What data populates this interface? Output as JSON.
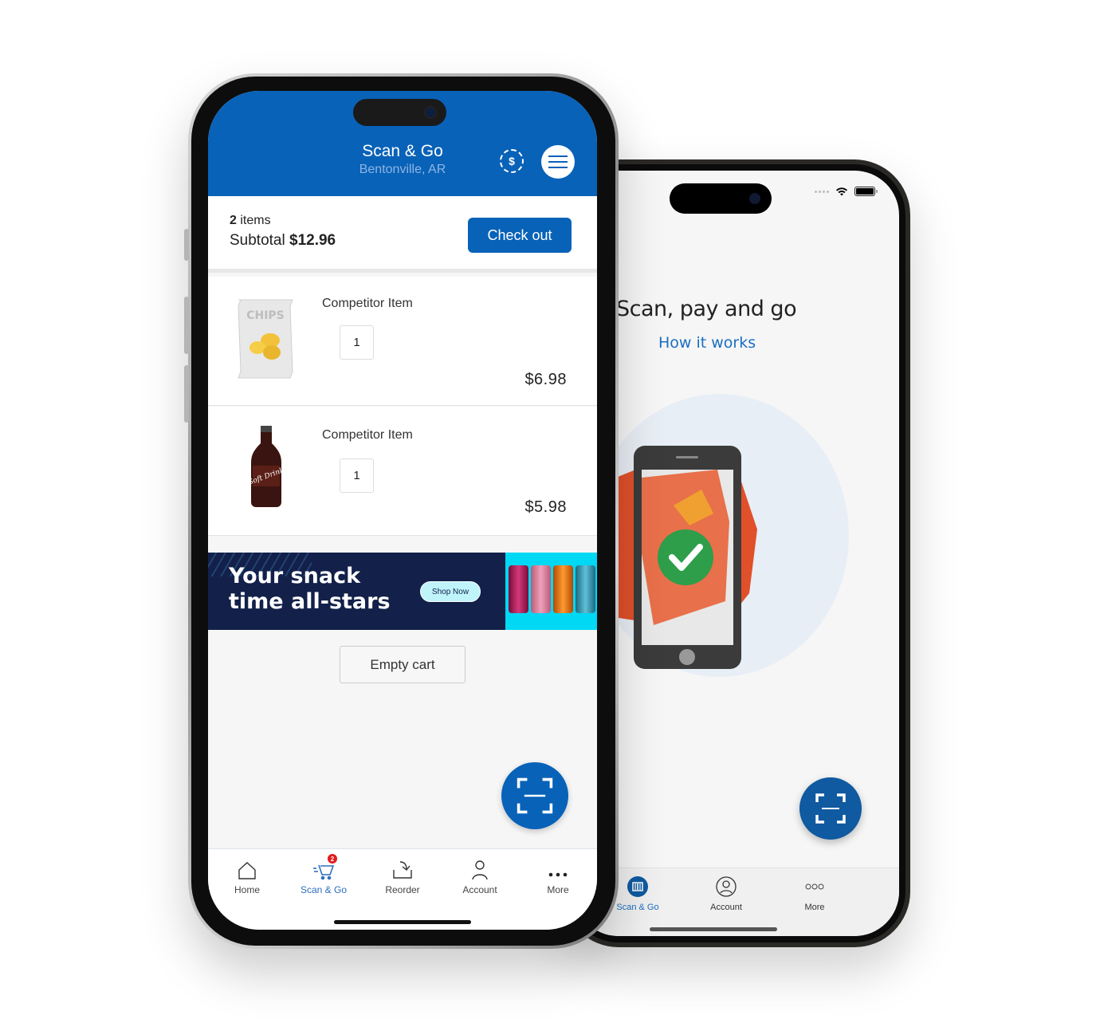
{
  "back_phone": {
    "headline": "Scan, pay and go",
    "link": "How it works",
    "tabs": [
      {
        "label": "Scan & Go",
        "icon": "barcode-icon",
        "active": true
      },
      {
        "label": "Account",
        "icon": "account-icon",
        "active": false
      },
      {
        "label": "More",
        "icon": "more-icon",
        "active": false
      }
    ]
  },
  "front_phone": {
    "header": {
      "title": "Scan & Go",
      "location": "Bentonville, AR",
      "dollar_icon": "$"
    },
    "summary": {
      "item_count": "2",
      "items_label": "items",
      "subtotal_label": "Subtotal",
      "subtotal_value": "$12.96",
      "checkout_label": "Check out"
    },
    "cart_items": [
      {
        "name": "Competitor Item",
        "quantity": "1",
        "price": "$6.98",
        "image": "chips-bag"
      },
      {
        "name": "Competitor Item",
        "quantity": "1",
        "price": "$5.98",
        "image": "soft-drink-bottle"
      }
    ],
    "banner": {
      "headline_line1": "Your snack",
      "headline_line2": "time all-stars",
      "cta": "Shop Now"
    },
    "empty_cart_label": "Empty cart",
    "tabs": [
      {
        "label": "Home",
        "icon": "home-icon",
        "active": false
      },
      {
        "label": "Scan & Go",
        "icon": "cart-icon",
        "active": true,
        "badge": "2"
      },
      {
        "label": "Reorder",
        "icon": "reorder-icon",
        "active": false
      },
      {
        "label": "Account",
        "icon": "account-icon",
        "active": false
      },
      {
        "label": "More",
        "icon": "more-icon",
        "active": false
      }
    ]
  },
  "colors": {
    "brand_blue": "#0862b8",
    "link_blue": "#1b6ec2",
    "banner_navy": "#12204a",
    "badge_red": "#e21b1b"
  }
}
